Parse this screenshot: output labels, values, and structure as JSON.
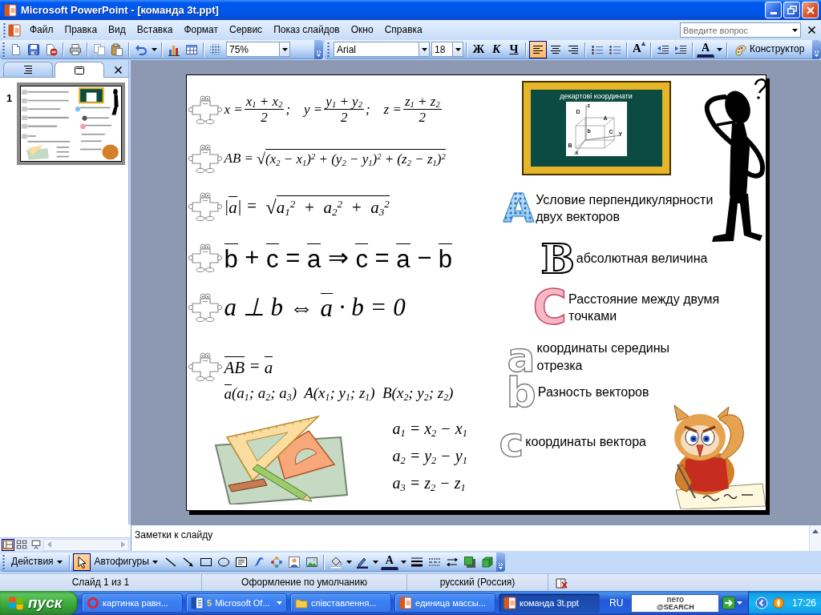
{
  "window": {
    "title": "Microsoft PowerPoint - [команда 3t.ppt]"
  },
  "menu": [
    "Файл",
    "Правка",
    "Вид",
    "Вставка",
    "Формат",
    "Сервис",
    "Показ слайдов",
    "Окно",
    "Справка"
  ],
  "help_search": {
    "placeholder": "Введите вопрос"
  },
  "standard_toolbar": [
    {
      "kind": "button",
      "pressed": false
    },
    {
      "kind": "button",
      "pressed": false
    },
    {
      "kind": "button",
      "pressed": false
    },
    {
      "kind": "separator"
    },
    {
      "kind": "button",
      "pressed": false
    },
    {
      "kind": "separator"
    },
    {
      "kind": "button",
      "pressed": false
    },
    {
      "kind": "button",
      "pressed": false
    },
    {
      "kind": "separator"
    },
    {
      "kind": "button",
      "pressed": false
    },
    {
      "kind": "arrow"
    },
    {
      "kind": "separator"
    },
    {
      "kind": "button",
      "pressed": false
    },
    {
      "kind": "button",
      "pressed": false
    },
    {
      "kind": "separator"
    },
    {
      "kind": "button",
      "pressed": false
    },
    {
      "kind": "combo",
      "value": "75%"
    },
    {
      "kind": "overflow"
    }
  ],
  "formatting_toolbar": [
    {
      "kind": "combo",
      "value": "Arial"
    },
    {
      "kind": "combo",
      "value": "18"
    },
    {
      "kind": "separator"
    },
    {
      "kind": "text",
      "label": "Ж",
      "pressed": false
    },
    {
      "kind": "text",
      "label": "К",
      "pressed": false
    },
    {
      "kind": "text",
      "label": "Ч",
      "pressed": false
    },
    {
      "kind": "separator"
    },
    {
      "kind": "button",
      "pressed": true
    },
    {
      "kind": "button",
      "pressed": false
    },
    {
      "kind": "button",
      "pressed": false
    },
    {
      "kind": "separator"
    },
    {
      "kind": "button",
      "pressed": false
    },
    {
      "kind": "button",
      "pressed": false
    },
    {
      "kind": "separator"
    },
    {
      "kind": "grow",
      "label": "A",
      "pressed": false
    },
    {
      "kind": "separator"
    },
    {
      "kind": "button",
      "pressed": false
    },
    {
      "kind": "button",
      "pressed": false
    },
    {
      "kind": "separator"
    },
    {
      "kind": "font-color",
      "label": "A",
      "pressed": false
    },
    {
      "kind": "arrow"
    },
    {
      "kind": "separator"
    },
    {
      "kind": "labeled",
      "label": "Конструктор",
      "pressed": false
    },
    {
      "kind": "overflow"
    }
  ],
  "panel_tabs": [
    {
      "selected": false
    },
    {
      "selected": true
    }
  ],
  "slides": [
    {
      "number": "1",
      "selected": true
    }
  ],
  "slide": {
    "formulas": [
      {
        "bullet": true,
        "parts": [
          {
            "kind": "text",
            "text": "x ="
          },
          {
            "kind": "frac",
            "num": "x$_{1}$ + x$_{2}$",
            "den": "2"
          },
          {
            "kind": "text",
            "text": ";    y ="
          },
          {
            "kind": "frac",
            "num": "y$_{1}$ + y$_{2}$",
            "den": "2"
          },
          {
            "kind": "text",
            "text": ";    z ="
          },
          {
            "kind": "frac",
            "num": "z$_{1}$ + z$_{2}$",
            "den": "2"
          }
        ]
      },
      {
        "bullet": true,
        "parts": [
          {
            "kind": "text",
            "text": "AB = "
          },
          {
            "kind": "sqrt",
            "sign": "√",
            "text": "(x$_{2}$ − x$_{1}$)$^{2}$ + (y$_{2}$ − y$_{1}$)$^{2}$ + (z$_{2}$ − z$_{1}$)$^{2}$"
          }
        ]
      },
      {
        "bullet": true,
        "parts": [
          {
            "kind": "text",
            "text": "|"
          },
          {
            "kind": "vec",
            "text": "a"
          },
          {
            "kind": "text",
            "text": "| =  "
          },
          {
            "kind": "sqrt",
            "sign": "√",
            "text": "a$_{1}$$^{2}$  +  a$_{2}$$^{2}$  +  a$_{3}$$^{2}$"
          }
        ]
      },
      {
        "bullet": true,
        "parts": [
          {
            "kind": "vec",
            "text": "b"
          },
          {
            "kind": "text",
            "text": " + "
          },
          {
            "kind": "vec",
            "text": "c"
          },
          {
            "kind": "text",
            "text": " = "
          },
          {
            "kind": "vec",
            "text": "a"
          },
          {
            "kind": "text",
            "text": " ⇒ "
          },
          {
            "kind": "vec",
            "text": "c"
          },
          {
            "kind": "text",
            "text": " = "
          },
          {
            "kind": "vec",
            "text": "a"
          },
          {
            "kind": "text",
            "text": " − "
          },
          {
            "kind": "vec",
            "text": "b"
          }
        ]
      },
      {
        "bullet": true,
        "parts": [
          {
            "kind": "text",
            "text": "a ⊥ b ⇔ "
          },
          {
            "kind": "vec",
            "text": "a"
          },
          {
            "kind": "text",
            "text": " · b = 0"
          }
        ]
      },
      {
        "bullet": true,
        "parts": [
          {
            "kind": "vec",
            "text": "AB"
          },
          {
            "kind": "text",
            "text": " = "
          },
          {
            "kind": "vec",
            "text": "a"
          }
        ]
      },
      {
        "bullet": false,
        "parts": [
          {
            "kind": "vec",
            "text": "a"
          },
          {
            "kind": "text",
            "text": "(a$_{1}$; a$_{2}$; a$_{3}$)  A(x$_{1}$; y$_{1}$; z$_{1}$)  B(x$_{2}$; y$_{2}$; z$_{2}$)"
          }
        ]
      },
      {
        "bullet": false,
        "parts": [
          {
            "kind": "text",
            "text": "a$_{1}$ = x$_{2}$ − x$_{1}$"
          }
        ]
      },
      {
        "bullet": false,
        "parts": [
          {
            "kind": "text",
            "text": "a$_{2}$ = y$_{2}$ − y$_{1}$"
          }
        ]
      },
      {
        "bullet": false,
        "parts": [
          {
            "kind": "text",
            "text": "a$_{3}$ = z$_{2}$ − z$_{1}$"
          }
        ]
      }
    ],
    "blackboard": {
      "title": "декартові координати",
      "labels": [
        "z",
        "D",
        "A",
        "C",
        "Y",
        "b",
        "B",
        "x"
      ]
    },
    "topics": [
      {
        "letter": "A",
        "kind": "patterned",
        "text": "Условие перпендикулярности двух векторов"
      },
      {
        "letter": "B",
        "kind": "cartoon",
        "text": "абсолютная величина"
      },
      {
        "letter": "C",
        "kind": "floral",
        "text": "Расстояние между двумя точками"
      },
      {
        "letter": "a",
        "kind": "outline",
        "text": "координаты середины отрезка"
      },
      {
        "letter": "b",
        "kind": "outline",
        "text": "Разность векторов"
      },
      {
        "letter": "c",
        "kind": "outline",
        "text": "координаты вектора"
      }
    ]
  },
  "notes": {
    "placeholder": "Заметки к слайду"
  },
  "view_buttons": [
    {
      "selected": true
    },
    {
      "selected": false
    },
    {
      "selected": false
    }
  ],
  "drawing_toolbar": [
    {
      "kind": "menu",
      "label": "Действия"
    },
    {
      "kind": "separator"
    },
    {
      "kind": "button",
      "pressed": true
    },
    {
      "kind": "menu",
      "label": "Автофигуры"
    },
    {
      "kind": "button",
      "pressed": false
    },
    {
      "kind": "button",
      "pressed": false
    },
    {
      "kind": "button",
      "pressed": false
    },
    {
      "kind": "button",
      "pressed": false
    },
    {
      "kind": "button",
      "pressed": false
    },
    {
      "kind": "button",
      "pressed": false
    },
    {
      "kind": "button",
      "pressed": false
    },
    {
      "kind": "button",
      "pressed": false
    },
    {
      "kind": "button",
      "pressed": false
    },
    {
      "kind": "separator"
    },
    {
      "kind": "button",
      "pressed": false
    },
    {
      "kind": "arrow"
    },
    {
      "kind": "button",
      "pressed": false
    },
    {
      "kind": "arrow"
    },
    {
      "kind": "font-color",
      "label": "A",
      "pressed": false
    },
    {
      "kind": "arrow"
    },
    {
      "kind": "button",
      "pressed": false
    },
    {
      "kind": "button",
      "pressed": false
    },
    {
      "kind": "button",
      "pressed": false
    },
    {
      "kind": "button",
      "pressed": false
    },
    {
      "kind": "button",
      "pressed": false
    },
    {
      "kind": "overflow"
    }
  ],
  "status_bar": [
    "Слайд 1 из 1",
    "Оформление по умолчанию",
    "русский (Россия)"
  ],
  "taskbar": {
    "start": "пуск",
    "tasks": [
      {
        "label": "картинка равн...",
        "selected": false
      },
      {
        "count": "5",
        "label": "Microsoft Of...",
        "selected": false
      },
      {
        "label": "співставлення...",
        "selected": false
      },
      {
        "label": "единица массы...",
        "selected": false
      },
      {
        "label": "команда 3t.ppt",
        "selected": true
      }
    ],
    "language": "RU",
    "search_logo": [
      "nero",
      "@SEARCH"
    ],
    "clock": "17:26"
  }
}
